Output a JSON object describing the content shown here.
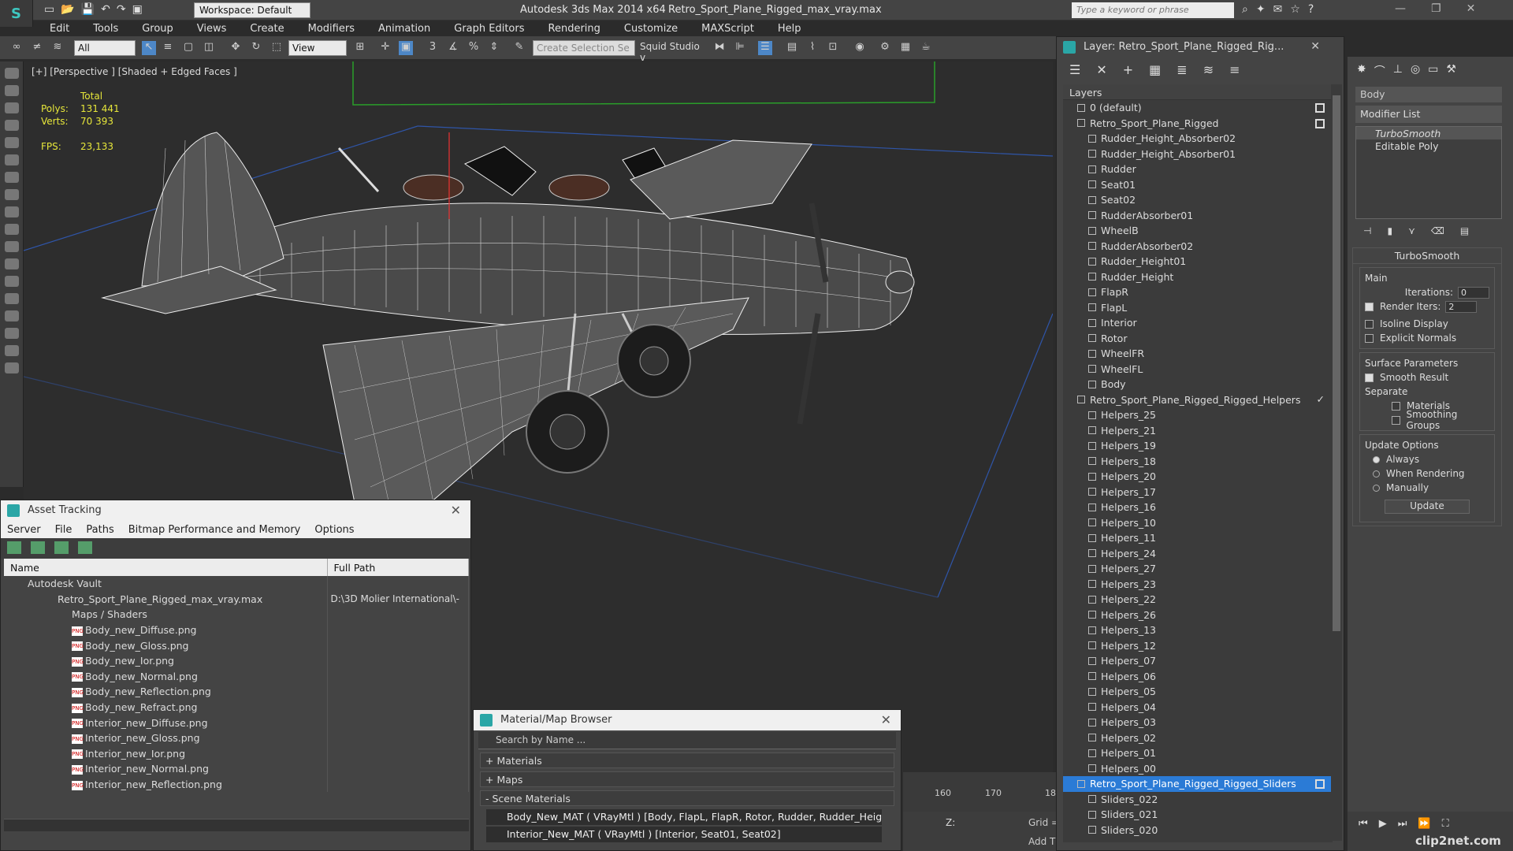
{
  "app": {
    "title": "Autodesk 3ds Max  2014 x64",
    "file": "Retro_Sport_Plane_Rigged_max_vray.max",
    "workspace": "Workspace: Default",
    "search_placeholder": "Type a keyword or phrase"
  },
  "menu": [
    "Edit",
    "Tools",
    "Group",
    "Views",
    "Create",
    "Modifiers",
    "Animation",
    "Graph Editors",
    "Rendering",
    "Customize",
    "MAXScript",
    "Help"
  ],
  "toolbar": {
    "filter_select": "All",
    "ref_coord": "View",
    "selection_set_placeholder": "Create Selection Se",
    "studio": "Squid Studio v"
  },
  "viewport": {
    "label": "[+] [Perspective ] [Shaded + Edged Faces ]",
    "stats": {
      "header": "Total",
      "polys_label": "Polys:",
      "polys": "131 441",
      "verts_label": "Verts:",
      "verts": "70 393",
      "fps_label": "FPS:",
      "fps": "23,133"
    }
  },
  "asset_tracking": {
    "title": "Asset Tracking",
    "menu": [
      "Server",
      "File",
      "Paths",
      "Bitmap Performance and Memory",
      "Options"
    ],
    "columns": [
      "Name",
      "Full Path"
    ],
    "rows": [
      {
        "name": "Autodesk Vault",
        "path": "",
        "indent": 0,
        "type": "vault"
      },
      {
        "name": "Retro_Sport_Plane_Rigged_max_vray.max",
        "path": "D:\\3D Molier International\\-",
        "indent": 1,
        "type": "max"
      },
      {
        "name": "Maps / Shaders",
        "path": "",
        "indent": 2,
        "type": "folder"
      },
      {
        "name": "Body_new_Diffuse.png",
        "path": "",
        "indent": 3,
        "type": "png"
      },
      {
        "name": "Body_new_Gloss.png",
        "path": "",
        "indent": 3,
        "type": "png"
      },
      {
        "name": "Body_new_Ior.png",
        "path": "",
        "indent": 3,
        "type": "png"
      },
      {
        "name": "Body_new_Normal.png",
        "path": "",
        "indent": 3,
        "type": "png"
      },
      {
        "name": "Body_new_Reflection.png",
        "path": "",
        "indent": 3,
        "type": "png"
      },
      {
        "name": "Body_new_Refract.png",
        "path": "",
        "indent": 3,
        "type": "png"
      },
      {
        "name": "Interior_new_Diffuse.png",
        "path": "",
        "indent": 3,
        "type": "png"
      },
      {
        "name": "Interior_new_Gloss.png",
        "path": "",
        "indent": 3,
        "type": "png"
      },
      {
        "name": "Interior_new_Ior.png",
        "path": "",
        "indent": 3,
        "type": "png"
      },
      {
        "name": "Interior_new_Normal.png",
        "path": "",
        "indent": 3,
        "type": "png"
      },
      {
        "name": "Interior_new_Reflection.png",
        "path": "",
        "indent": 3,
        "type": "png"
      }
    ]
  },
  "material_browser": {
    "title": "Material/Map Browser",
    "search_placeholder": "Search by Name ...",
    "categories": [
      "+ Materials",
      "+ Maps",
      "- Scene Materials"
    ],
    "materials": [
      "Body_New_MAT  ( VRayMtl )  [Body, FlapL, FlapR, Rotor, Rudder, Rudder_Height...",
      "Interior_New_MAT  ( VRayMtl )  [Interior, Seat01, Seat02]"
    ]
  },
  "layers": {
    "title": "Layer: Retro_Sport_Plane_Rigged_Rig...",
    "header": "Layers",
    "items": [
      {
        "label": "0 (default)",
        "level": 0,
        "checkbox": true
      },
      {
        "label": "Retro_Sport_Plane_Rigged",
        "level": 0,
        "checkbox": true
      },
      {
        "label": "Rudder_Height_Absorber02",
        "level": 1
      },
      {
        "label": "Rudder_Height_Absorber01",
        "level": 1
      },
      {
        "label": "Rudder",
        "level": 1
      },
      {
        "label": "Seat01",
        "level": 1
      },
      {
        "label": "Seat02",
        "level": 1
      },
      {
        "label": "RudderAbsorber01",
        "level": 1
      },
      {
        "label": "WheelB",
        "level": 1
      },
      {
        "label": "RudderAbsorber02",
        "level": 1
      },
      {
        "label": "Rudder_Height01",
        "level": 1
      },
      {
        "label": "Rudder_Height",
        "level": 1
      },
      {
        "label": "FlapR",
        "level": 1
      },
      {
        "label": "FlapL",
        "level": 1
      },
      {
        "label": "Interior",
        "level": 1
      },
      {
        "label": "Rotor",
        "level": 1
      },
      {
        "label": "WheelFR",
        "level": 1
      },
      {
        "label": "WheelFL",
        "level": 1
      },
      {
        "label": "Body",
        "level": 1
      },
      {
        "label": "Retro_Sport_Plane_Rigged_Rigged_Helpers",
        "level": 0,
        "check": true
      },
      {
        "label": "Helpers_25",
        "level": 1
      },
      {
        "label": "Helpers_21",
        "level": 1
      },
      {
        "label": "Helpers_19",
        "level": 1
      },
      {
        "label": "Helpers_18",
        "level": 1
      },
      {
        "label": "Helpers_20",
        "level": 1
      },
      {
        "label": "Helpers_17",
        "level": 1
      },
      {
        "label": "Helpers_16",
        "level": 1
      },
      {
        "label": "Helpers_10",
        "level": 1
      },
      {
        "label": "Helpers_11",
        "level": 1
      },
      {
        "label": "Helpers_24",
        "level": 1
      },
      {
        "label": "Helpers_27",
        "level": 1
      },
      {
        "label": "Helpers_23",
        "level": 1
      },
      {
        "label": "Helpers_22",
        "level": 1
      },
      {
        "label": "Helpers_26",
        "level": 1
      },
      {
        "label": "Helpers_13",
        "level": 1
      },
      {
        "label": "Helpers_12",
        "level": 1
      },
      {
        "label": "Helpers_07",
        "level": 1
      },
      {
        "label": "Helpers_06",
        "level": 1
      },
      {
        "label": "Helpers_05",
        "level": 1
      },
      {
        "label": "Helpers_04",
        "level": 1
      },
      {
        "label": "Helpers_03",
        "level": 1
      },
      {
        "label": "Helpers_02",
        "level": 1
      },
      {
        "label": "Helpers_01",
        "level": 1
      },
      {
        "label": "Helpers_00",
        "level": 1
      },
      {
        "label": "Retro_Sport_Plane_Rigged_Rigged_Sliders",
        "level": 0,
        "selected": true,
        "checkbox": true
      },
      {
        "label": "Sliders_022",
        "level": 1
      },
      {
        "label": "Sliders_021",
        "level": 1
      },
      {
        "label": "Sliders_020",
        "level": 1
      }
    ]
  },
  "command_panel": {
    "object_name": "Body",
    "modifier_list": "Modifier List",
    "stack": [
      "TurboSmooth",
      "Editable Poly"
    ],
    "turbosmooth": {
      "title": "TurboSmooth",
      "main": "Main",
      "iterations_label": "Iterations:",
      "iterations": "0",
      "render_iters_label": "Render Iters:",
      "render_iters": "2",
      "isoline": "Isoline Display",
      "explicit": "Explicit Normals",
      "surface_params": "Surface Parameters",
      "smooth_result": "Smooth Result",
      "separate": "Separate",
      "materials": "Materials",
      "smoothing_groups": "Smoothing Groups",
      "update_options": "Update Options",
      "always": "Always",
      "when_rendering": "When Rendering",
      "manually": "Manually",
      "update_button": "Update"
    }
  },
  "timeline": {
    "ticks": [
      "160",
      "170",
      "18"
    ]
  },
  "status": {
    "z_label": "Z:",
    "grid_label": "Grid =",
    "add_label": "Add T"
  },
  "watermark": "clip2net.com"
}
